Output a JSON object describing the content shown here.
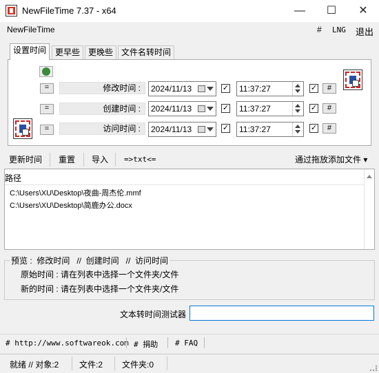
{
  "window": {
    "title": "NewFileTime 7.37 - x64",
    "minimize_glyph": "—",
    "maximize_glyph": "☐",
    "close_glyph": "✕"
  },
  "menubar": {
    "app_label": "NewFileTime",
    "hash_label": "#",
    "lng_label": "LNG",
    "exit_label": "退出"
  },
  "tabs": [
    {
      "label": "设置时间",
      "active": true
    },
    {
      "label": "更早些",
      "active": false
    },
    {
      "label": "更晚些",
      "active": false
    },
    {
      "label": "文件名转时间",
      "active": false
    }
  ],
  "time_rows": [
    {
      "eq_label": "=",
      "label": "修改时间 :",
      "date": "2024/11/13",
      "time": "11:37:27",
      "date_checked": true,
      "time_checked": true,
      "hash_label": "#"
    },
    {
      "eq_label": "=",
      "label": "创建时间 :",
      "date": "2024/11/13",
      "time": "11:37:27",
      "date_checked": true,
      "time_checked": true,
      "hash_label": "#"
    },
    {
      "eq_label": "=",
      "label": "访问时间 :",
      "date": "2024/11/13",
      "time": "11:37:27",
      "date_checked": true,
      "time_checked": true,
      "hash_label": "#"
    }
  ],
  "toolbar": {
    "update_label": "更新时间",
    "reset_label": "重置",
    "import_label": "导入",
    "txt_label": "=>txt<=",
    "drag_add_label": "通过拖放添加文件",
    "drag_add_arrow": "▾"
  },
  "file_list": {
    "header": "路径",
    "rows": [
      "C:\\Users\\XU\\Desktop\\夜曲-周杰伦.mmf",
      "C:\\Users\\XU\\Desktop\\简鹿办公.docx"
    ]
  },
  "preview": {
    "caption": "预览 :  修改时间   //  创建时间   //  访问时间",
    "original_time": "原始时间 : 请在列表中选择一个文件夹/文件",
    "new_time": "新的时间 : 请在列表中选择一个文件夹/文件"
  },
  "tester": {
    "label": "文本转时间测试器",
    "value": ""
  },
  "footer_links": [
    "# http://www.softwareok.com",
    "# 捐助",
    "# FAQ"
  ],
  "status": {
    "ready": "就绪 // 对象:2",
    "files": "文件:2",
    "folders": "文件夹:0"
  },
  "icons": {
    "app": "app-logo-icon",
    "refresh": "refresh-icon",
    "file_time": "file-time-icon",
    "calendar": "calendar-icon",
    "dropdown": "chevron-down-icon"
  },
  "colors": {
    "accent_input_border": "#0078d7",
    "icon_red": "#cc2222",
    "icon_blue": "#2a4fa8",
    "refresh_green": "#3a8a3a"
  }
}
